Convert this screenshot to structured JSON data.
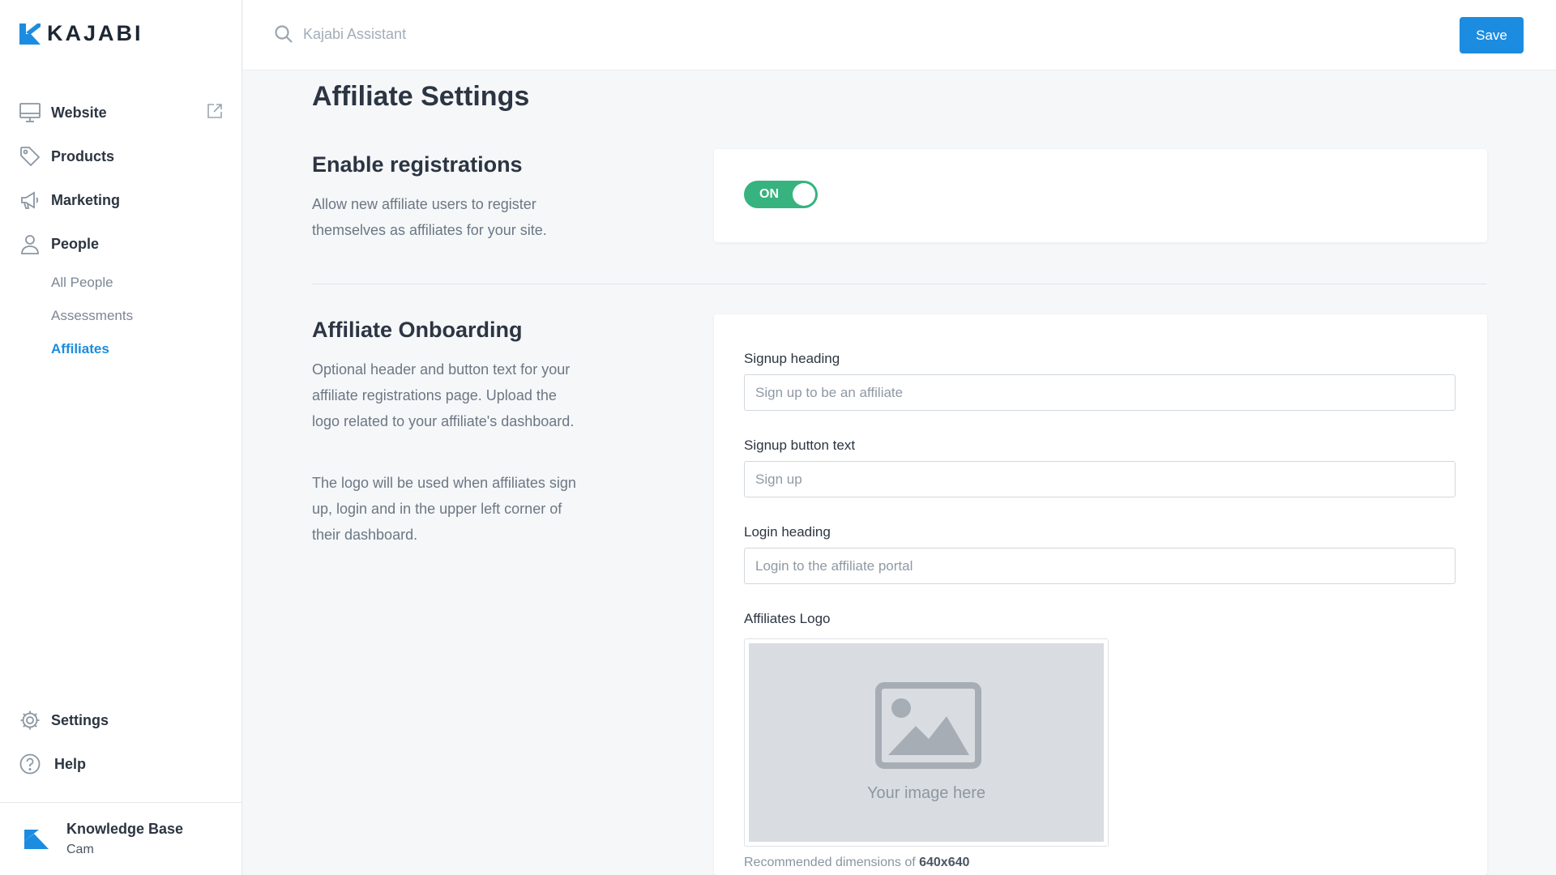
{
  "brand": {
    "name": "KAJABI",
    "color": "#1c8ce0"
  },
  "sidebar": {
    "items": [
      {
        "label": "Website",
        "icon": "monitor-icon"
      },
      {
        "label": "Products",
        "icon": "tag-icon"
      },
      {
        "label": "Marketing",
        "icon": "megaphone-icon"
      },
      {
        "label": "People",
        "icon": "person-icon"
      }
    ],
    "people_sub": [
      "All People",
      "Assessments",
      "Affiliates"
    ],
    "active_sub": "Affiliates",
    "bottom": [
      {
        "label": "Settings",
        "icon": "gear-icon"
      },
      {
        "label": "Help",
        "icon": "help-icon"
      }
    ],
    "knowledge_base": {
      "title": "Knowledge Base",
      "subtitle": "Cam"
    }
  },
  "header": {
    "search_placeholder": "Kajabi Assistant",
    "save_label": "Save"
  },
  "page": {
    "title": "Affiliate Settings",
    "registrations": {
      "title": "Enable registrations",
      "description": "Allow new affiliate users to register themselves as affiliates for your site.",
      "toggle_label": "ON",
      "toggle_on": true,
      "toggle_color": "#36b37e"
    },
    "onboarding": {
      "title": "Affiliate Onboarding",
      "description_1": "Optional header and button text for your affiliate registrations page. Upload the logo related to your affiliate's dashboard.",
      "description_2": "The logo will be used when affiliates sign up, login and in the upper left corner of their dashboard.",
      "fields": {
        "signup_heading": {
          "label": "Signup heading",
          "placeholder": "Sign up to be an affiliate",
          "value": ""
        },
        "signup_button": {
          "label": "Signup button text",
          "placeholder": "Sign up",
          "value": ""
        },
        "login_heading": {
          "label": "Login heading",
          "placeholder": "Login to the affiliate portal",
          "value": ""
        }
      },
      "logo": {
        "label": "Affiliates Logo",
        "placeholder_text": "Your image here",
        "recommended_prefix": "Recommended dimensions of",
        "recommended_value": "640x640"
      }
    }
  }
}
